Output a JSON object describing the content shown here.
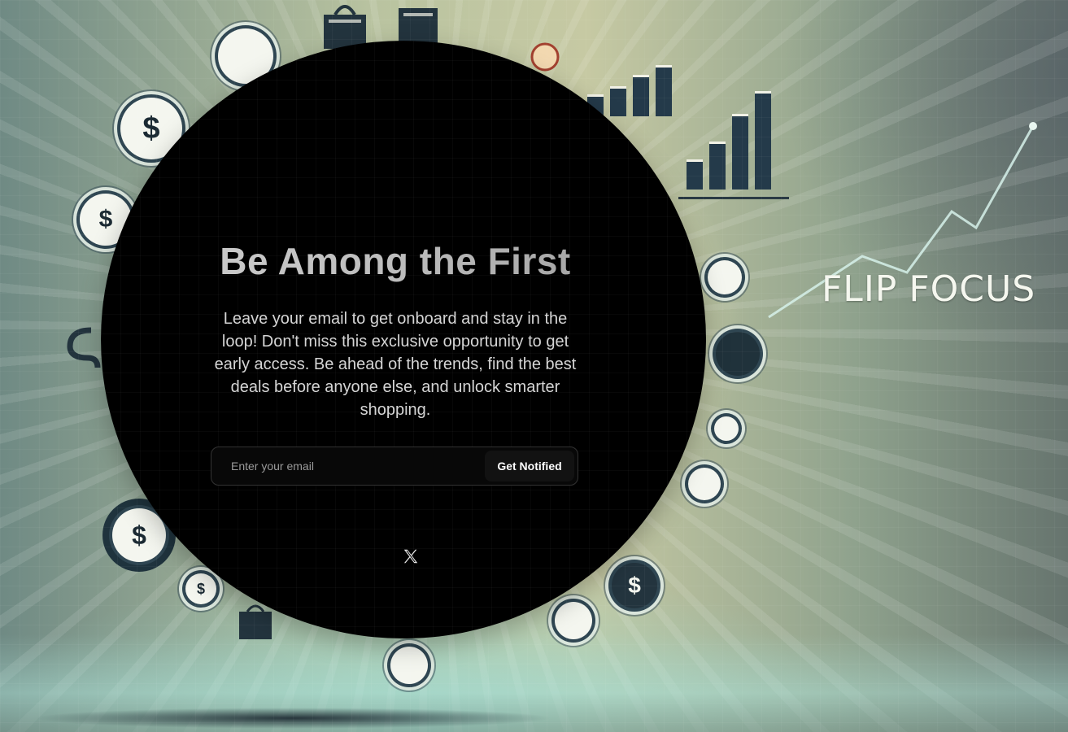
{
  "background": {
    "brand_part_1": "FLIP",
    "brand_part_2": "FOCUS",
    "coin_symbol": "$"
  },
  "signup": {
    "title": "Be Among the First",
    "description": "Leave your email to get onboard and stay in the loop! Don't miss this exclusive opportunity to get early access. Be ahead of the trends, find the best deals before anyone else, and unlock smarter shopping.",
    "email_placeholder": "Enter your email",
    "email_value": "",
    "button_label": "Get Notified"
  },
  "social": {
    "icons": [
      "x-icon"
    ]
  },
  "colors": {
    "panel": "#000000",
    "button": "#121212",
    "text": "#d5d5d5"
  }
}
